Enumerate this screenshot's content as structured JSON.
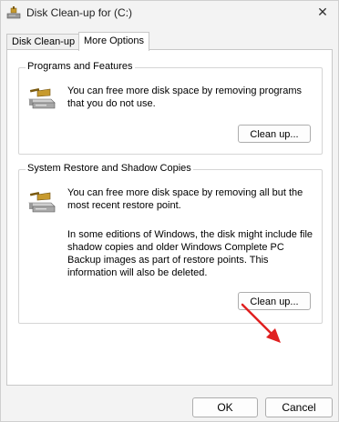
{
  "window": {
    "title": "Disk Clean-up for  (C:)"
  },
  "tabs": [
    {
      "label": "Disk Clean-up",
      "active": false
    },
    {
      "label": "More Options",
      "active": true
    }
  ],
  "groups": {
    "programs": {
      "title": "Programs and Features",
      "description": "You can free more disk space by removing programs that you do not use.",
      "button": "Clean up..."
    },
    "restore": {
      "title": "System Restore and Shadow Copies",
      "description": "You can free more disk space by removing all but the most recent restore point.",
      "note": "In some editions of Windows, the disk might include file shadow copies and older Windows Complete PC Backup images as part of restore points. This information will also be deleted.",
      "button": "Clean up..."
    }
  },
  "footer": {
    "ok": "OK",
    "cancel": "Cancel"
  },
  "icons": {
    "title": "disk-cleanup-icon",
    "group": "hard-drive-with-brush-icon",
    "close": "close-icon",
    "annotation": "red-arrow-annotation"
  },
  "colors": {
    "annotation": "#e02020",
    "accent": "#0067c0"
  }
}
